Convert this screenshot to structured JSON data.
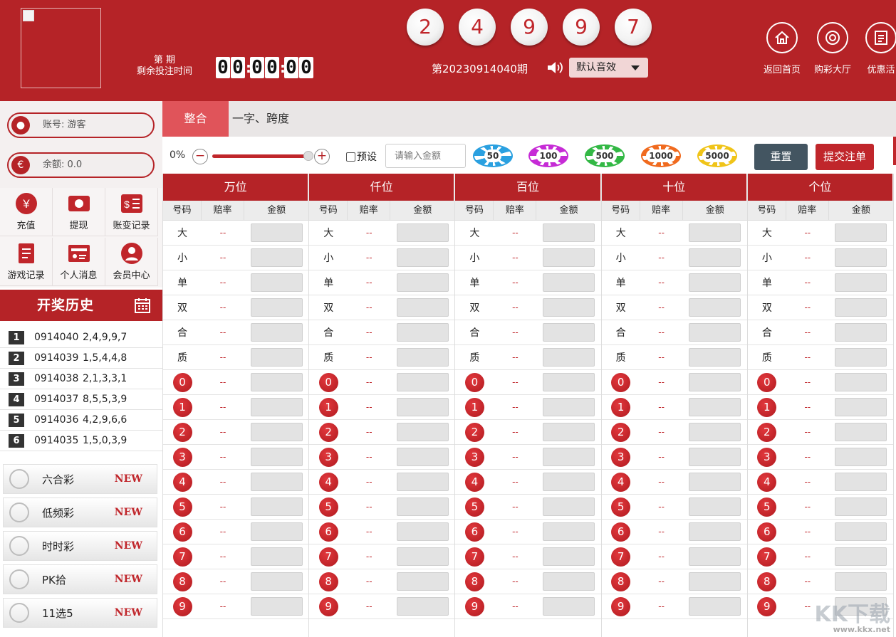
{
  "header": {
    "period_label_1": "第 期",
    "period_label_2": "剩余投注时间",
    "timer": [
      "0",
      "0",
      "0",
      "0",
      "0",
      "0"
    ],
    "balls": [
      "2",
      "4",
      "9",
      "9",
      "7"
    ],
    "issue": "第20230914040期",
    "sound_label": "默认音效",
    "nav": [
      {
        "label": "返回首页",
        "icon": "home-icon"
      },
      {
        "label": "购彩大厅",
        "icon": "lottery-hall-icon"
      },
      {
        "label": "优惠活",
        "icon": "promo-icon"
      }
    ]
  },
  "sidebar": {
    "account_label": "账号: 游客",
    "balance_label": "余额: 0.0",
    "quick_actions": [
      {
        "label": "充值",
        "icon": "yen-icon"
      },
      {
        "label": "提现",
        "icon": "wallet-icon"
      },
      {
        "label": "账变记录",
        "icon": "statement-icon"
      },
      {
        "label": "游戏记录",
        "icon": "document-icon"
      },
      {
        "label": "个人消息",
        "icon": "message-icon"
      },
      {
        "label": "会员中心",
        "icon": "user-icon"
      }
    ],
    "history_title": "开奖历史",
    "history": [
      {
        "rank": "1",
        "issue": "0914040",
        "numbers": "2,4,9,9,7"
      },
      {
        "rank": "2",
        "issue": "0914039",
        "numbers": "1,5,4,4,8"
      },
      {
        "rank": "3",
        "issue": "0914038",
        "numbers": "2,1,3,3,1"
      },
      {
        "rank": "4",
        "issue": "0914037",
        "numbers": "8,5,5,3,9"
      },
      {
        "rank": "5",
        "issue": "0914036",
        "numbers": "4,2,9,6,6"
      },
      {
        "rank": "6",
        "issue": "0914035",
        "numbers": "1,5,0,3,9"
      }
    ],
    "games": [
      {
        "label": "六合彩",
        "badge": "NEW"
      },
      {
        "label": "低频彩",
        "badge": "NEW"
      },
      {
        "label": "时时彩",
        "badge": "NEW"
      },
      {
        "label": "PK拾",
        "badge": "NEW"
      },
      {
        "label": "11选5",
        "badge": "NEW"
      }
    ]
  },
  "tabs": [
    "整合",
    "一字、跨度"
  ],
  "toolbar": {
    "percent": "0%",
    "minus": "−",
    "plus": "+",
    "preset_label": "预设",
    "amount_placeholder": "请输入金额",
    "chips": [
      "50",
      "100",
      "500",
      "1000",
      "5000"
    ],
    "chip_colors": [
      "#2aa0e0",
      "#c62bd6",
      "#33b845",
      "#f06a1e",
      "#f0c419"
    ],
    "reset_label": "重置",
    "submit_label": "提交注单"
  },
  "grid": {
    "columns": [
      "万位",
      "仟位",
      "百位",
      "十位",
      "个位"
    ],
    "subheaders": [
      "号码",
      "赔率",
      "金额"
    ],
    "text_rows": [
      "大",
      "小",
      "单",
      "双",
      "合",
      "质"
    ],
    "number_rows": [
      "0",
      "1",
      "2",
      "3",
      "4",
      "5",
      "6",
      "7",
      "8",
      "9"
    ],
    "odds_placeholder": "--"
  },
  "watermark": {
    "main": "KK下载",
    "sub": "www.kkx.net"
  }
}
